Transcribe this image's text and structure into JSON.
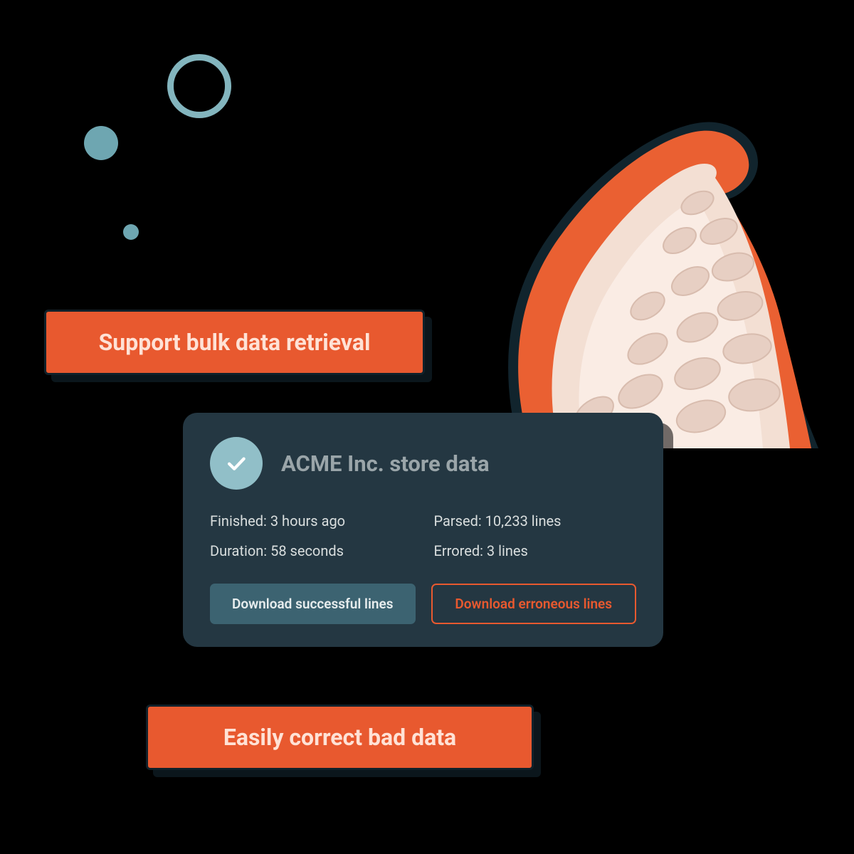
{
  "badges": {
    "top": "Support bulk data retrieval",
    "bottom": "Easily correct bad data"
  },
  "card": {
    "title": "ACME Inc. store data",
    "finished": "Finished: 3 hours ago",
    "duration": "Duration: 58 seconds",
    "parsed": "Parsed: 10,233 lines",
    "errored": "Errored: 3 lines",
    "download_success": "Download successful lines",
    "download_error": "Download erroneous lines"
  },
  "decor": {
    "tentacle": "tentacle-illustration",
    "bubbles": "bubbles"
  }
}
